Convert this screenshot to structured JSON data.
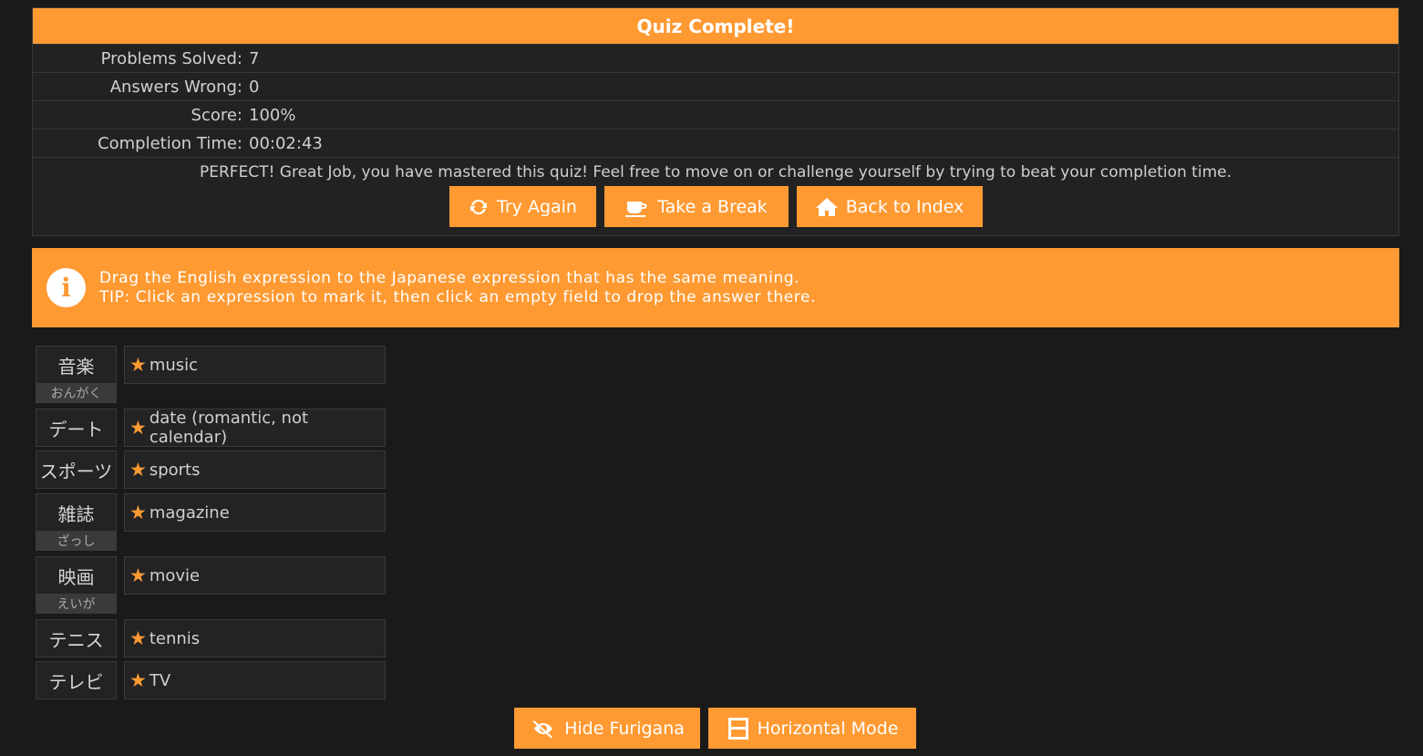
{
  "results": {
    "title": "Quiz Complete!",
    "stats": [
      {
        "label": "Problems Solved:",
        "value": "7"
      },
      {
        "label": "Answers Wrong:",
        "value": "0"
      },
      {
        "label": "Score:",
        "value": "100%"
      },
      {
        "label": "Completion Time:",
        "value": "00:02:43"
      }
    ],
    "message": "PERFECT! Great Job, you have mastered this quiz! Feel free to move on or challenge yourself by trying to beat your completion time.",
    "buttons": {
      "try_again": "Try Again",
      "take_break": "Take a Break",
      "back_index": "Back to Index"
    }
  },
  "info": {
    "line1": "Drag the English expression to the Japanese expression that has the same meaning.",
    "line2": "TIP: Click an expression to mark it, then click an empty field to drop the answer there."
  },
  "pairs": [
    {
      "jp": "音楽",
      "furigana": "おんがく",
      "en": "music"
    },
    {
      "jp": "デート",
      "furigana": "",
      "en": "date (romantic, not calendar)"
    },
    {
      "jp": "スポーツ",
      "furigana": "",
      "en": "sports"
    },
    {
      "jp": "雑誌",
      "furigana": "ざっし",
      "en": "magazine"
    },
    {
      "jp": "映画",
      "furigana": "えいが",
      "en": "movie"
    },
    {
      "jp": "テニス",
      "furigana": "",
      "en": "tennis"
    },
    {
      "jp": "テレビ",
      "furigana": "",
      "en": "TV"
    }
  ],
  "bottom": {
    "hide_furigana": "Hide Furigana",
    "horizontal_mode": "Horizontal Mode"
  },
  "colors": {
    "accent": "#ff9a33",
    "background": "#1a1a1a"
  }
}
